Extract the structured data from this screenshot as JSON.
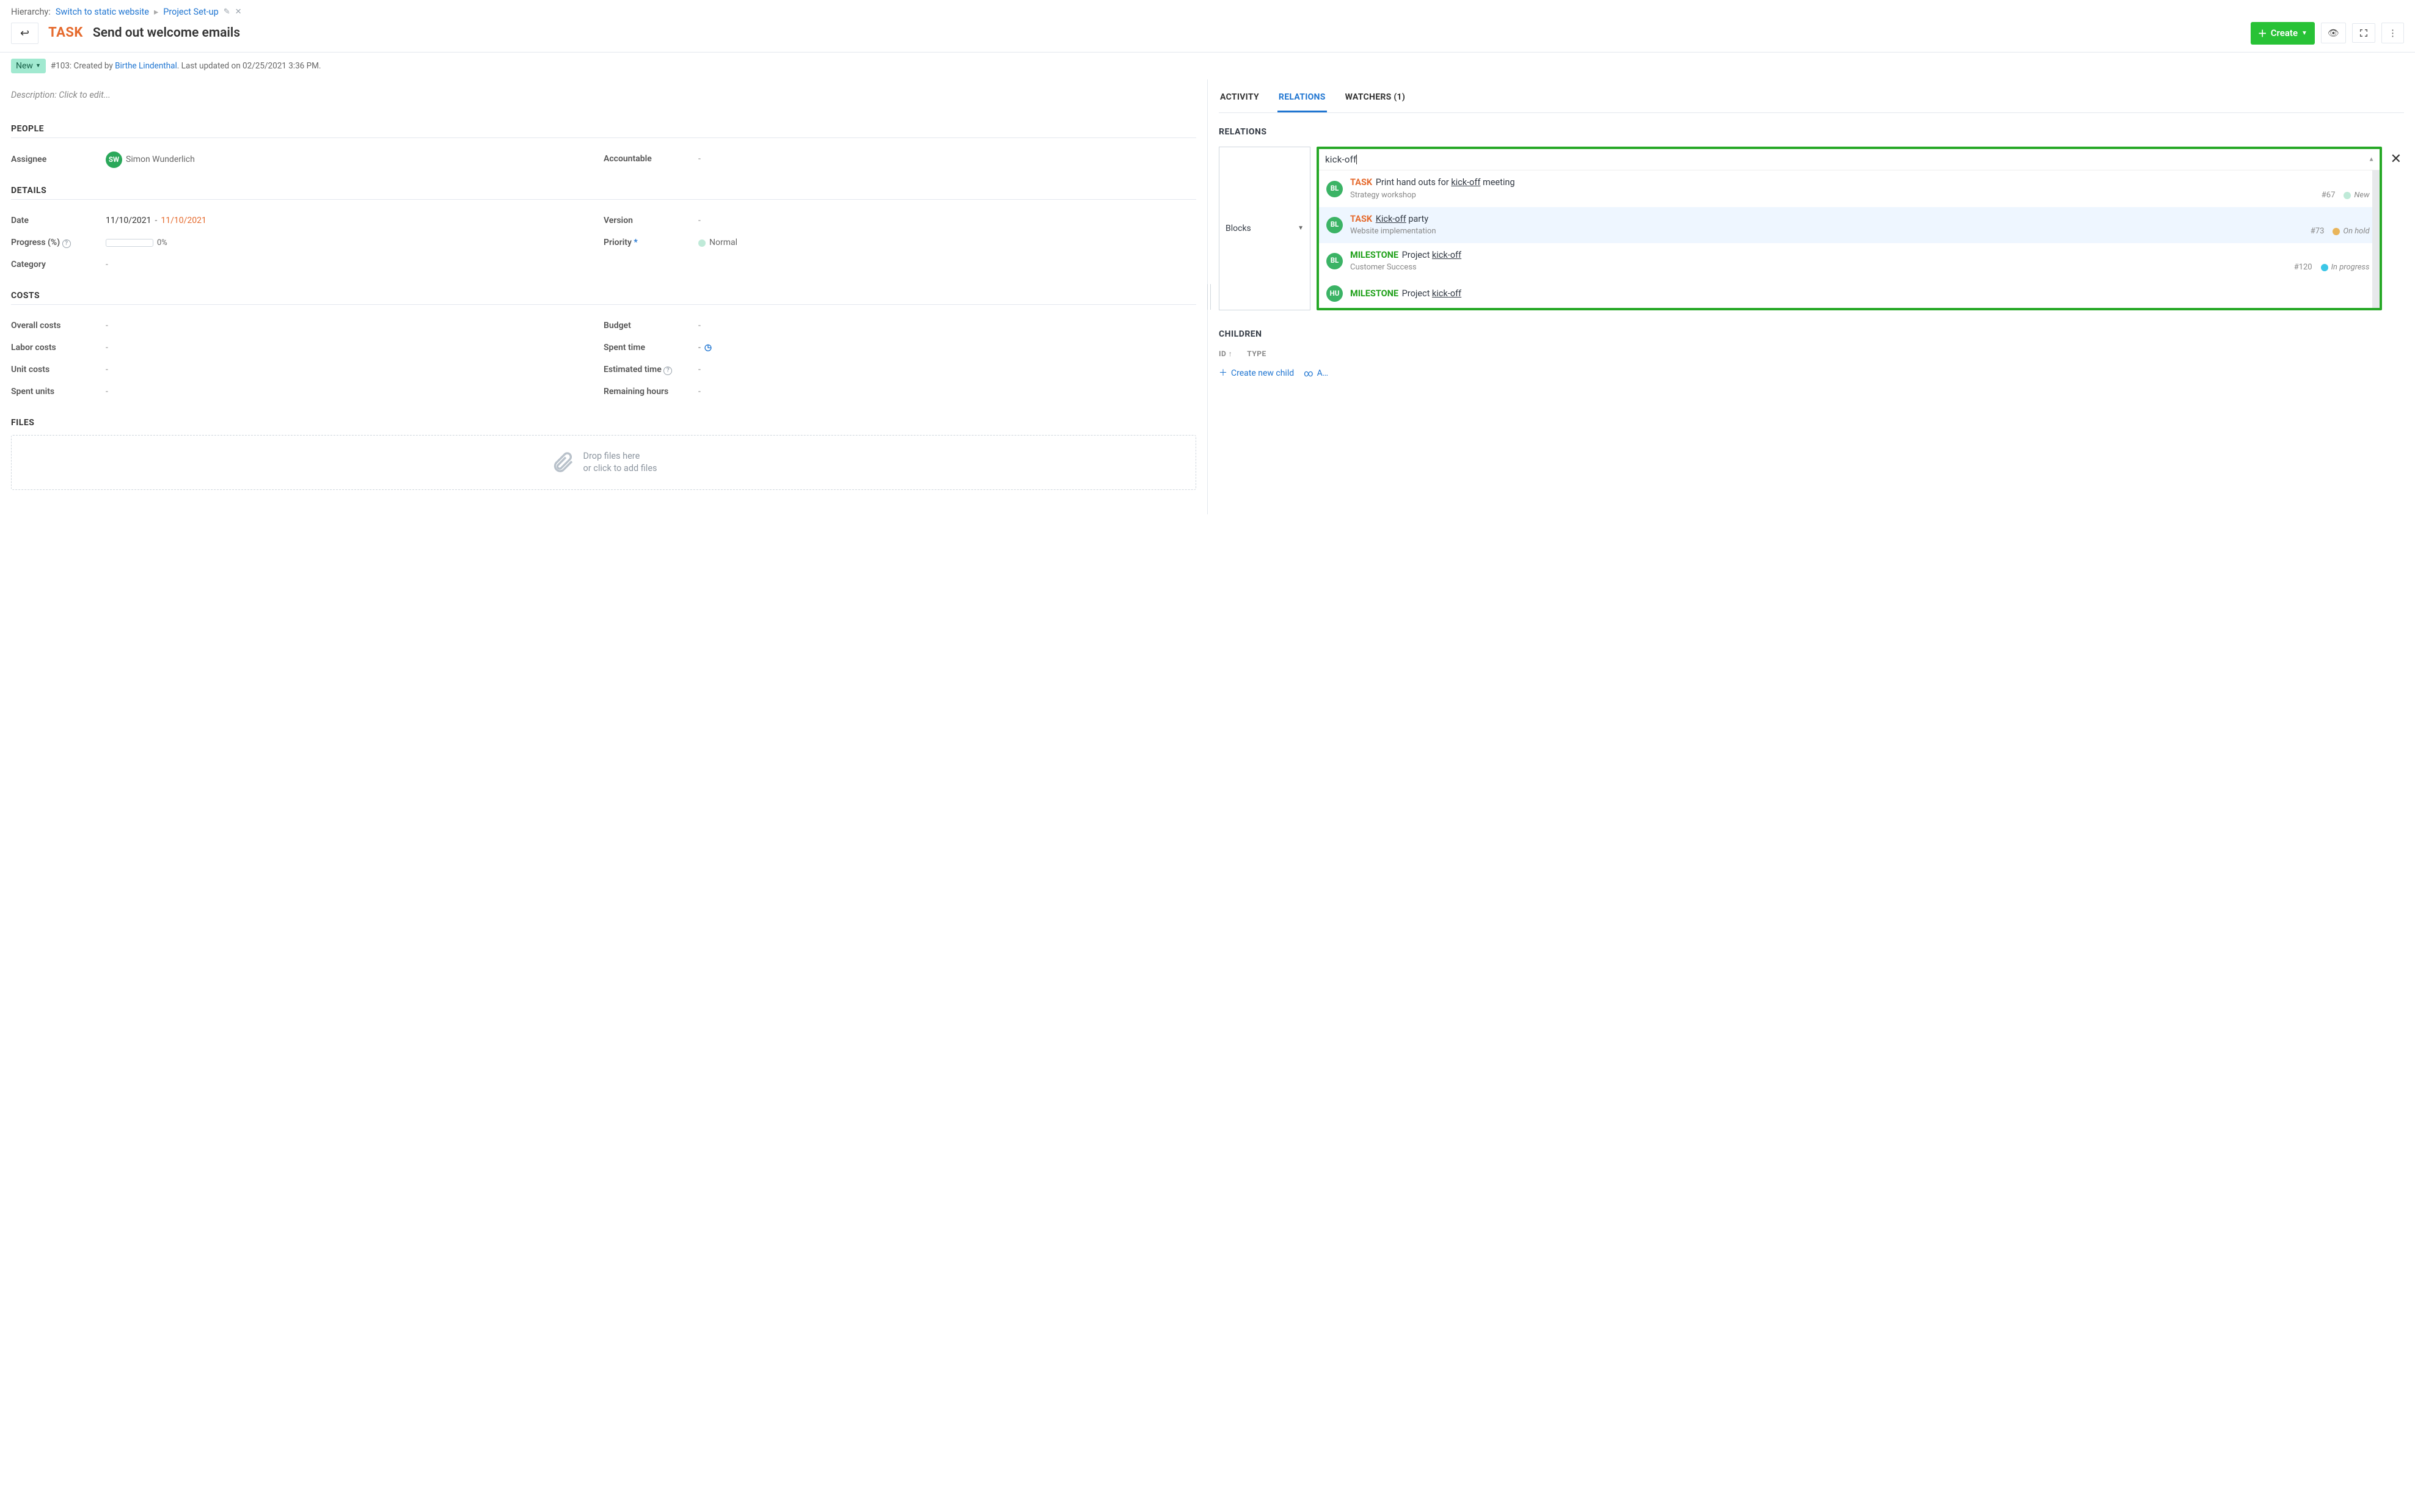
{
  "breadcrumb": {
    "label": "Hierarchy:",
    "items": [
      "Switch to static website",
      "Project Set-up"
    ]
  },
  "header": {
    "back": "↩",
    "type": "TASK",
    "title": "Send out welcome emails",
    "create": "Create"
  },
  "meta": {
    "status": "New",
    "id_prefix": "#103: Created by ",
    "author": "Birthe Lindenthal",
    "updated": ". Last updated on 02/25/2021 3:36 PM."
  },
  "description_placeholder": "Description: Click to edit...",
  "sections": {
    "people": "PEOPLE",
    "details": "DETAILS",
    "costs": "COSTS",
    "files": "FILES"
  },
  "people": {
    "assignee_label": "Assignee",
    "assignee_initials": "SW",
    "assignee_name": "Simon Wunderlich",
    "accountable_label": "Accountable",
    "accountable_value": "-"
  },
  "details": {
    "date_label": "Date",
    "date_start": "11/10/2021",
    "date_sep": " - ",
    "date_end": "11/10/2021",
    "version_label": "Version",
    "version_value": "-",
    "progress_label": "Progress (%)",
    "progress_text": "0%",
    "priority_label": "Priority",
    "priority_value": "Normal",
    "category_label": "Category",
    "category_value": "-"
  },
  "costs": {
    "overall_label": "Overall costs",
    "overall_value": "-",
    "budget_label": "Budget",
    "budget_value": "-",
    "labor_label": "Labor costs",
    "labor_value": "-",
    "spent_time_label": "Spent time",
    "spent_time_value": "-",
    "unit_label": "Unit costs",
    "unit_value": "-",
    "est_label": "Estimated time",
    "est_value": "-",
    "spent_units_label": "Spent units",
    "spent_units_value": "-",
    "remaining_label": "Remaining hours",
    "remaining_value": "-"
  },
  "dropzone": {
    "line1": "Drop files here",
    "line2": "or click to add files"
  },
  "tabs": {
    "activity": "ACTIVITY",
    "relations": "RELATIONS",
    "watchers": "WATCHERS (1)"
  },
  "relations": {
    "heading": "RELATIONS",
    "type_selected": "Blocks",
    "search_value": "kick-off",
    "results": [
      {
        "initials": "BL",
        "type": "TASK",
        "title_pre": "Print hand outs for ",
        "hl": "kick-off",
        "title_post": " meeting",
        "project": "Strategy workshop",
        "id": "#67",
        "status": "New",
        "dot": "mint"
      },
      {
        "initials": "BL",
        "type": "TASK",
        "title_pre": "",
        "hl": "Kick-off",
        "title_post": " party",
        "project": "Website implementation",
        "id": "#73",
        "status": "On hold",
        "dot": "orange",
        "selected": true
      },
      {
        "initials": "BL",
        "type": "MILESTONE",
        "title_pre": "Project ",
        "hl": "kick-off",
        "title_post": "",
        "project": "Customer Success",
        "id": "#120",
        "status": "In progress",
        "dot": "cyan"
      },
      {
        "initials": "HU",
        "type": "MILESTONE",
        "title_pre": "Project ",
        "hl": "kick-off",
        "title_post": "",
        "project": "",
        "id": "",
        "status": "",
        "dot": ""
      }
    ]
  },
  "children": {
    "heading": "CHILDREN",
    "col_id": "ID",
    "col_type": "TYPE",
    "create_child": "Create new child",
    "add_existing": "Add existing"
  }
}
